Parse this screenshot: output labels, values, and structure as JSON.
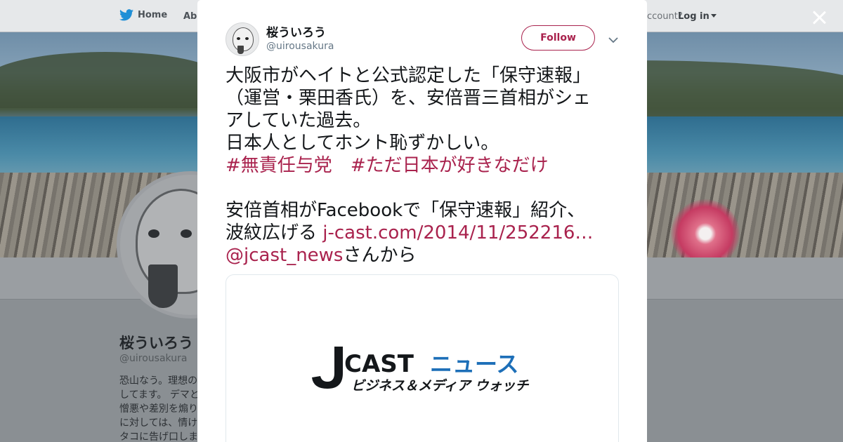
{
  "topbar": {
    "home_label": "Home",
    "about_label": "Abo",
    "account_prompt": "ccount?",
    "login_label": "Log in"
  },
  "profile": {
    "name": "桜ういろう",
    "handle": "@uirousakura",
    "bio_lines": [
      "恐山なう。理想の",
      "してます。 デマと",
      "憎悪や差別を煽り",
      "に対しては、情け",
      "タコに告げ口しま"
    ]
  },
  "tweet": {
    "display_name": "桜ういろう",
    "screen_name": "@uirousakura",
    "follow_label": "Follow",
    "lines": [
      "大阪市がヘイトと公式認定した「保守速報」",
      "（運営・栗田香氏）を、安倍晋三首相がシェ",
      "アしていた過去。",
      "日本人としてホント恥ずかしい。"
    ],
    "hashtags": [
      "#無責任与党",
      "#ただ日本が好きなだけ"
    ],
    "line_after_1": "安倍首相がFacebookで「保守速報」紹介、",
    "line_after_2_prefix": "波紋広げる ",
    "url_text": "j-cast.com/2014/11/252216…",
    "mention": "@jcast_news",
    "mention_suffix": "さんから"
  },
  "card": {
    "logo_letters": "CAST",
    "logo_katakana": "ニュース",
    "logo_tagline": "ビジネス＆メディア ウォッチ"
  },
  "colors": {
    "accent": "#a9224d",
    "text": "#14171a",
    "secondary": "#657786",
    "jcast_blue": "#1d6fb8"
  }
}
